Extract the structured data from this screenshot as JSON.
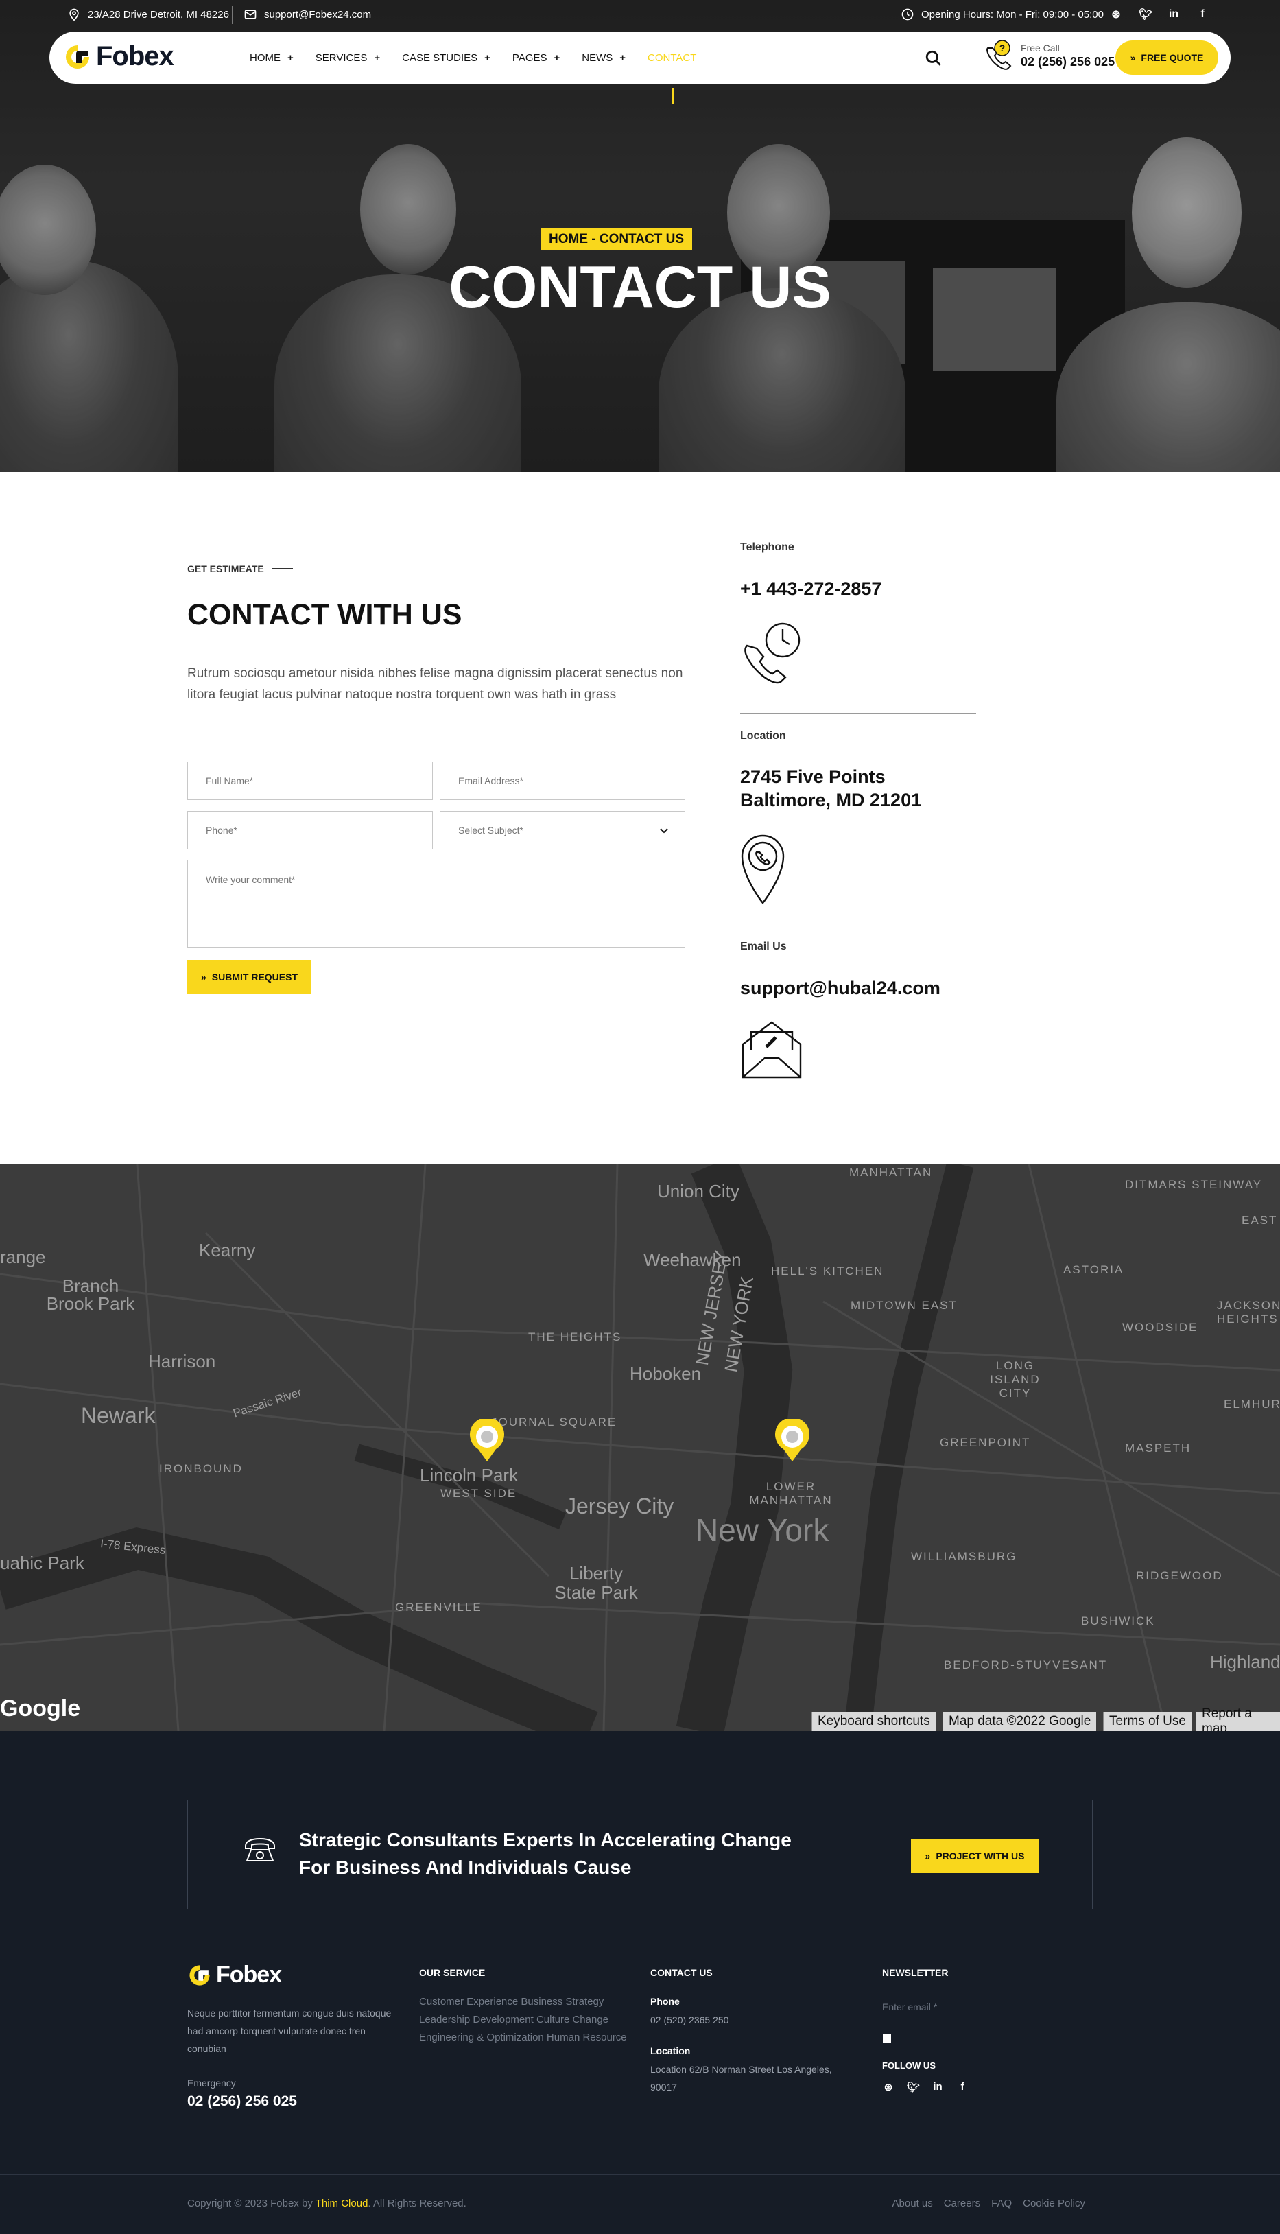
{
  "topbar": {
    "address": "23/A28 Drive Detroit, MI 48226",
    "email": "support@Fobex24.com",
    "hours": "Opening Hours: Mon - Fri: 09:00 - 05:00",
    "social_icons": [
      "dribbble-icon",
      "twitter-icon",
      "linkedin-icon",
      "facebook-icon"
    ]
  },
  "nav": {
    "logo": "Fobex",
    "items": [
      {
        "label": "HOME"
      },
      {
        "label": "SERVICES"
      },
      {
        "label": "CASE STUDIES"
      },
      {
        "label": "PAGES"
      },
      {
        "label": "NEWS"
      },
      {
        "label": "CONTACT"
      }
    ],
    "call_label": "Free Call",
    "call_number": "02 (256) 256 025",
    "quote_button": "FREE QUOTE"
  },
  "hero": {
    "breadcrumb": "HOME - CONTACT US",
    "title": "CONTACT US"
  },
  "contact": {
    "eyebrow": "GET ESTIMEATE",
    "title": "CONTACT WITH US",
    "lead": "Rutrum sociosqu ametour nisida nibhes felise magna dignissim placerat senectus non litora feugiat lacus pulvinar natoque nostra torquent own was hath in grass",
    "form": {
      "full_name": "Full Name*",
      "email": "Email Address*",
      "phone": "Phone*",
      "subject": "Select Subject*",
      "comment": "Write your comment*",
      "submit": "SUBMIT REQUEST"
    },
    "info": [
      {
        "label": "Telephone",
        "value": "+1 443-272-2857"
      },
      {
        "label": "Location",
        "value": "2745 Five Points\nBaltimore, MD 21201"
      },
      {
        "label": "Email Us",
        "value": "support@hubal24.com"
      }
    ]
  },
  "map": {
    "labels": [
      "MANHATTAN",
      "Union City",
      "DITMARS STEINWAY",
      "EAST E",
      "range",
      "Kearny",
      "Weehawken",
      "HELL'S KITCHEN",
      "ASTORIA",
      "Branch Brook Park",
      "MIDTOWN EAST",
      "JACKSON HEIGHTS",
      "THE HEIGHTS",
      "WOODSIDE",
      "Harrison",
      "Hoboken",
      "NEW JERSEY",
      "NEW YORK",
      "LONG ISLAND CITY",
      "Passaic River",
      "Newark",
      "ELMHUR",
      "JOURNAL SQUARE",
      "GREENPOINT",
      "MASPETH",
      "IRONBOUND",
      "Lincoln Park",
      "WEST SIDE",
      "LOWER MANHATTAN",
      "Jersey City",
      "New York",
      "I-78 Express",
      "uahic Park",
      "WILLIAMSBURG",
      "RIDGEWOOD",
      "Liberty State Park",
      "GREENVILLE",
      "BUSHWICK",
      "BEDFORD-STUYVESANT",
      "Highland Pa"
    ],
    "logo": "Google",
    "attributions": [
      "Keyboard shortcuts",
      "Map data ©2022 Google",
      "Terms of Use",
      "Report a map"
    ]
  },
  "footer": {
    "cta_text_line1": "Strategic Consultants Experts In Accelerating Change",
    "cta_text_line2": "For Business And Individuals Cause",
    "cta_button": "PROJECT WITH US",
    "logo": "Fobex",
    "about": "Neque porttitor fermentum congue duis natoque had amcorp torquent vulputate donec tren conubian",
    "emergency_label": "Emergency",
    "emergency_phone": "02 (256) 256 025",
    "service_title": "OUR SERVICE",
    "services": [
      "Customer Experience Business Strategy",
      "Leadership Development Culture Change",
      "Engineering & Optimization Human Resource"
    ],
    "contact_title": "CONTACT US",
    "phone_label": "Phone",
    "phone": "02 (520) 2365 250",
    "location_label": "Location",
    "location": "Location 62/B Norman Street Los Angeles, 90017",
    "newsletter_title": "NEWSLETTER",
    "newsletter_placeholder": "Enter email *",
    "follow_label": "FOLLOW US",
    "copyright_pre": "Copyright © 2023 Fobex by ",
    "copyright_brand": "Thim Cloud",
    "copyright_post": ". All Rights Reserved.",
    "links": [
      "About us",
      "Careers",
      "FAQ",
      "Cookie Policy"
    ]
  },
  "colors": {
    "accent": "#f9d71c",
    "footer_bg": "#161c26",
    "map_bg": "#3c3c3c"
  }
}
